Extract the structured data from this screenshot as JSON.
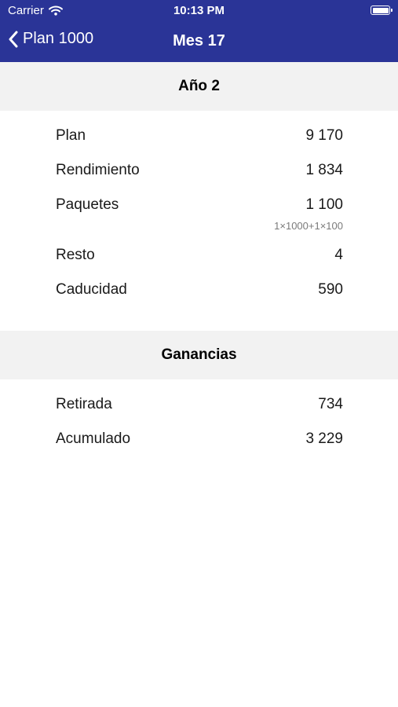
{
  "status_bar": {
    "carrier": "Carrier",
    "time": "10:13 PM"
  },
  "nav": {
    "back_label": "Plan 1000",
    "title": "Mes 17"
  },
  "sections": [
    {
      "header": "Año 2",
      "rows": [
        {
          "label": "Plan",
          "value": "9 170"
        },
        {
          "label": "Rendimiento",
          "value": "1 834"
        },
        {
          "label": "Paquetes",
          "value": "1 100",
          "detail": "1×1000+1×100"
        },
        {
          "label": "Resto",
          "value": "4"
        },
        {
          "label": "Caducidad",
          "value": "590"
        }
      ]
    },
    {
      "header": "Ganancias",
      "rows": [
        {
          "label": "Retirada",
          "value": "734"
        },
        {
          "label": "Acumulado",
          "value": "3 229"
        }
      ]
    }
  ],
  "colors": {
    "nav_background": "#2a3497",
    "section_header_background": "#f2f2f2"
  },
  "icons": {
    "wifi": "wifi-icon",
    "battery": "battery-icon",
    "back": "chevron-left-icon"
  }
}
